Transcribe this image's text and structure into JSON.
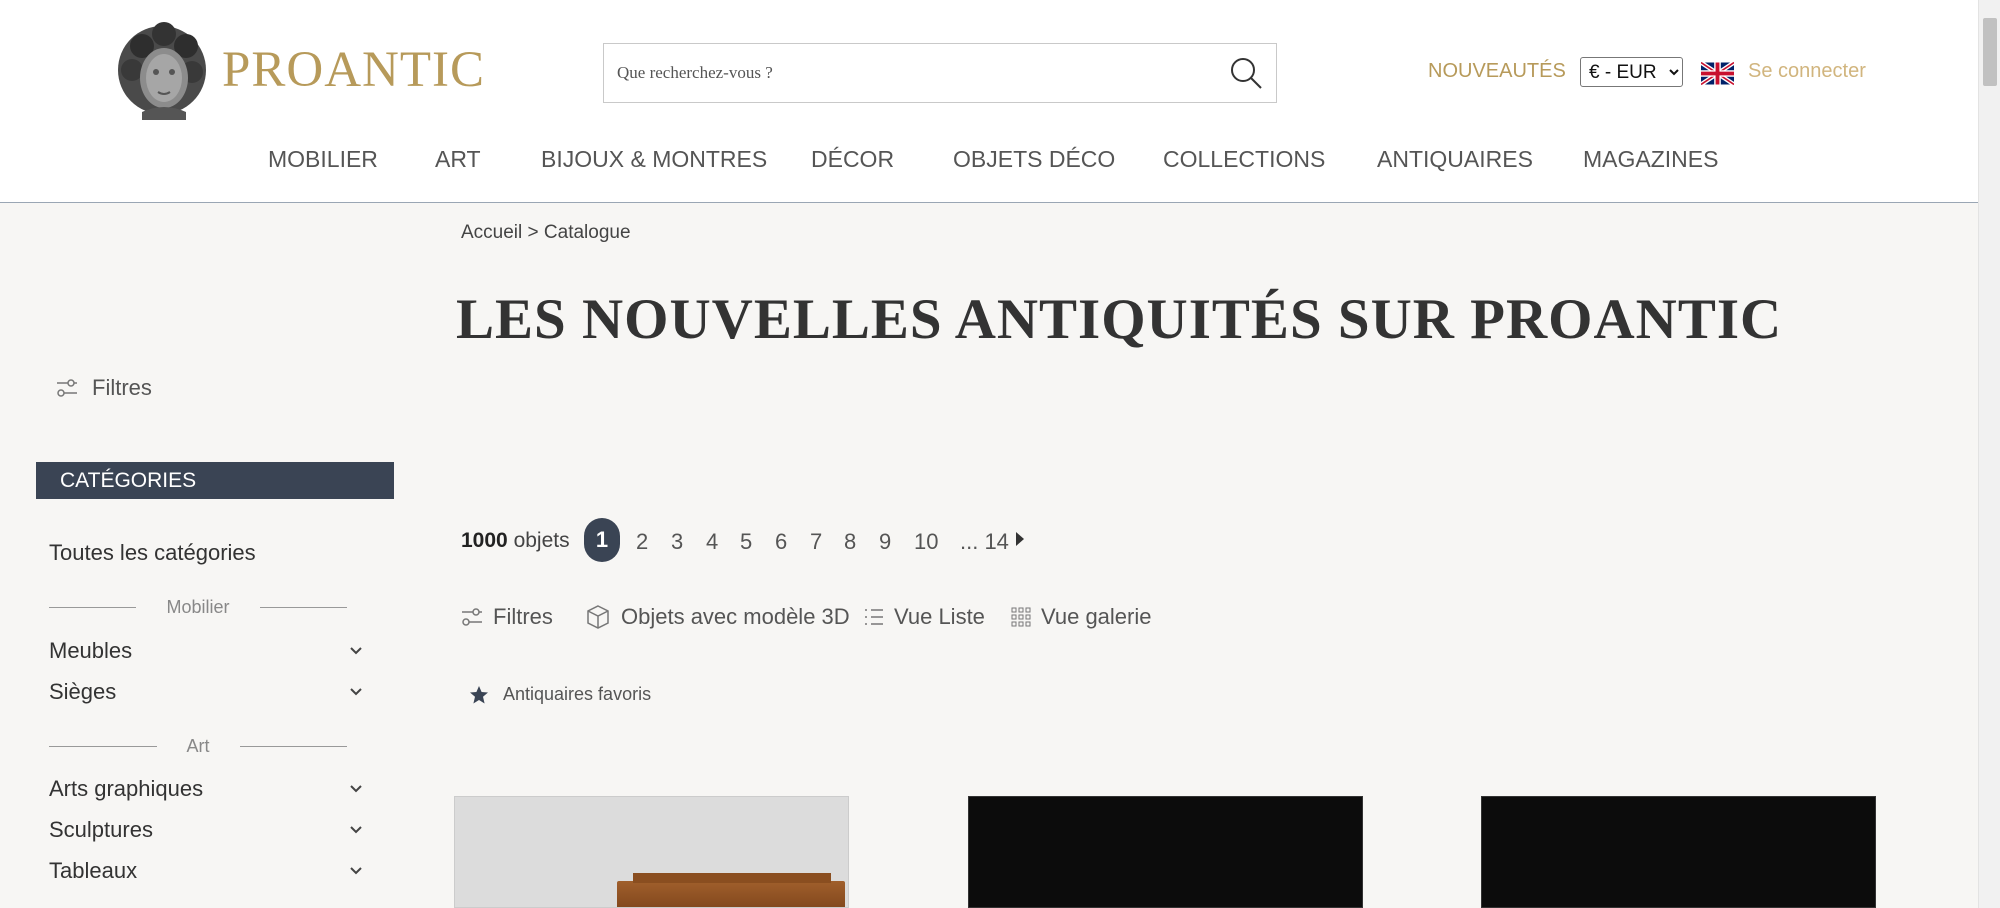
{
  "header": {
    "logo_text": "PROANTIC",
    "search_placeholder": "Que recherchez-vous ?",
    "nouveautes": "NOUVEAUTÉS",
    "currency": "€ - EUR",
    "login": "Se connecter"
  },
  "nav": [
    "MOBILIER",
    "ART",
    "BIJOUX & MONTRES",
    "DÉCOR",
    "OBJETS DÉCO",
    "COLLECTIONS",
    "ANTIQUAIRES",
    "MAGAZINES"
  ],
  "sidebar": {
    "filtres": "Filtres",
    "categories_title": "CATÉGORIES",
    "all_categories": "Toutes les catégories",
    "sections": [
      {
        "title": "Mobilier",
        "items": [
          "Meubles",
          "Sièges"
        ]
      },
      {
        "title": "Art",
        "items": [
          "Arts graphiques",
          "Sculptures",
          "Tableaux"
        ]
      }
    ]
  },
  "main": {
    "breadcrumb": "Accueil > Catalogue",
    "title": "LES NOUVELLES ANTIQUITÉS SUR PROANTIC",
    "count_number": "1000",
    "count_label": "objets",
    "pages": [
      "1",
      "2",
      "3",
      "4",
      "5",
      "6",
      "7",
      "8",
      "9",
      "10",
      "... 14"
    ],
    "current_page": "1",
    "toolbar": {
      "filtres": "Filtres",
      "objets_3d": "Objets avec modèle 3D",
      "vue_liste": "Vue Liste",
      "vue_galerie": "Vue galerie"
    },
    "antiquaires_favoris": "Antiquaires favoris"
  },
  "colors": {
    "brand_gold": "#b79a5a",
    "dark_slate": "#3a4454",
    "background": "#f7f6f4"
  }
}
